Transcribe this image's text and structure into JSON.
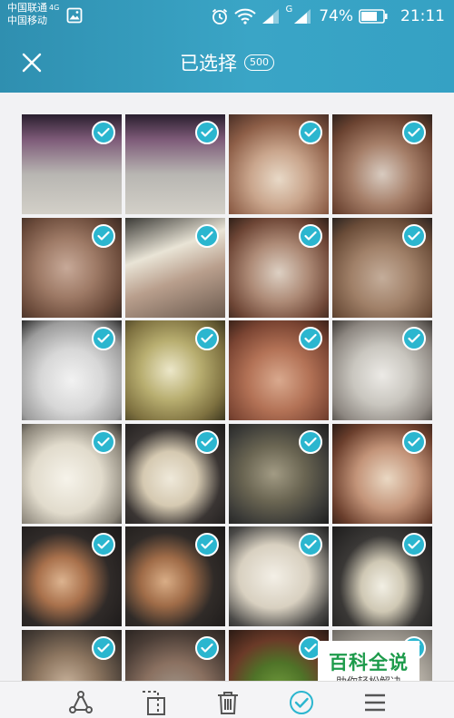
{
  "status_bar": {
    "carrier_1": "中国联通",
    "carrier_1_network": "4G",
    "carrier_2": "中国移动",
    "signal_2_label": "G",
    "battery_percent": "74%",
    "battery_level": 0.74,
    "time": "21:11"
  },
  "header": {
    "title": "已选择",
    "selected_count": "500"
  },
  "grid": {
    "columns": 4,
    "check_color": "#2bb6cf",
    "tiles": [
      {
        "bg": "linear-gradient(180deg,#2a1f2e 0%,#7d5a78 25%,#b8b6b2 60%,#d3d0c8 100%)",
        "selected": true
      },
      {
        "bg": "linear-gradient(180deg,#2a1f2e 0%,#7d5a78 25%,#b8b6b2 60%,#d3d0c8 100%)",
        "selected": true
      },
      {
        "bg": "radial-gradient(circle at 50% 65%,#e8d9c7 0%,#c9a58c 35%,#8d5e47 70%,#4a2f26 100%)",
        "selected": true
      },
      {
        "bg": "radial-gradient(circle at 50% 60%,#d8cbc0 0%,#a57e68 40%,#6b4331 75%,#2f221c 100%)",
        "selected": true
      },
      {
        "bg": "radial-gradient(circle at 45% 50%,#c7a998 0%,#9e7a66 40%,#6a4a3a 75%,#3a2a22 100%)",
        "selected": true
      },
      {
        "bg": "linear-gradient(160deg,#3b3a36 0%,#e9e4d6 35%,#b99f8d 60%,#6b5a4e 100%)",
        "selected": true
      },
      {
        "bg": "radial-gradient(circle at 50% 55%,#ddd0c3 0%,#ad8a76 40%,#6d4535 75%,#2f2018 100%)",
        "selected": true
      },
      {
        "bg": "radial-gradient(circle at 50% 60%,#c4ad9a 0%,#a08068 40%,#6a4c38 75%,#2a2320 100%)",
        "selected": true
      },
      {
        "bg": "radial-gradient(circle at 50% 60%,#f2f2f2 0%,#d7d7d7 40%,#9c9c9c 75%,#2c2c2c 100%)",
        "selected": true
      },
      {
        "bg": "radial-gradient(circle at 45% 50%,#ece7c9 0%,#b8ae70 40%,#7e7140 75%,#3e3820 100%)",
        "selected": true
      },
      {
        "bg": "radial-gradient(circle at 50% 60%,#d9a98e 0%,#b37256 40%,#7a4432 75%,#3a2219 100%)",
        "selected": true
      },
      {
        "bg": "radial-gradient(circle at 50% 55%,#eceae6 0%,#c9c6bf 40%,#8c8680 75%,#3e3a36 100%)",
        "selected": true
      },
      {
        "bg": "radial-gradient(circle at 45% 55%,#f6f3ea 0%,#e1dbcc 45%,#8a8478 80%,#2f2d2a 100%)",
        "selected": true
      },
      {
        "bg": "radial-gradient(ellipse at 45% 55%,#efe9da 0%,#d5c9b1 35%,#3a3533 65%,#1d1b1b 100%)",
        "selected": true
      },
      {
        "bg": "radial-gradient(ellipse at 45% 50%,#a29b84 0%,#6a6552 40%,#3a3a37 75%,#1e1e1e 100%)",
        "selected": true
      },
      {
        "bg": "radial-gradient(circle at 55% 55%,#ead8c3 0%,#c39479 40%,#6a3e2c 75%,#2a1a14 100%)",
        "selected": true
      },
      {
        "bg": "radial-gradient(circle at 40% 55%,#dcb38f 0%,#a9714c 30%,#2f2a28 60%,#1a1818 100%)",
        "selected": true
      },
      {
        "bg": "radial-gradient(circle at 40% 55%,#d9ad86 0%,#a06c48 30%,#302b28 60%,#1b1919 100%)",
        "selected": true
      },
      {
        "bg": "radial-gradient(ellipse at 45% 50%,#f3efe6 0%,#d8d0c0 45%,#4b4a48 80%,#222 100%)",
        "selected": true
      },
      {
        "bg": "radial-gradient(ellipse at 50% 60%,#f2efe4 0%,#cfc8b4 30%,#3a3836 60%,#1d1c1c 100%)",
        "selected": true
      },
      {
        "bg": "radial-gradient(circle at 45% 55%,#c7b19a 0%,#8d7660 40%,#4a4038 75%,#262220 100%)",
        "selected": true
      },
      {
        "bg": "radial-gradient(circle at 50% 65%,#a2988c 0%,#8a7060 40%,#4a3d36 75%,#2b2522 100%)",
        "selected": true
      },
      {
        "bg": "radial-gradient(circle at 50% 60%,#6f9a3c 0%,#4f7328 35%,#6b3a28 65%,#2a1a14 100%)",
        "selected": true
      },
      {
        "bg": "radial-gradient(circle at 50% 60%,#e8e4dc 0%,#b6b0a6 50%,#6e6a64 100%)",
        "selected": true
      }
    ]
  },
  "watermark": {
    "title": "百科全说",
    "subtitle": "助你轻松解决"
  },
  "toolbar": {
    "items": [
      "share-icon",
      "crop-select-icon",
      "delete-icon",
      "select-all-icon",
      "menu-icon"
    ],
    "active_color": "#2bb6cf",
    "icon_color": "#555555"
  }
}
